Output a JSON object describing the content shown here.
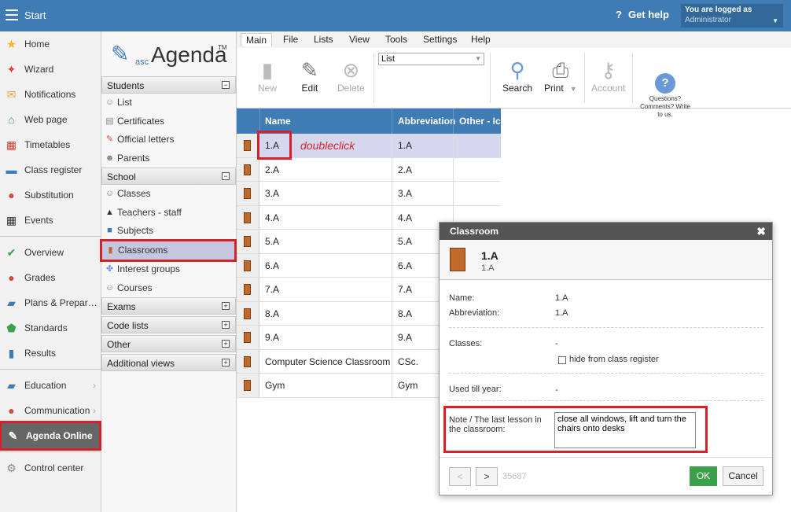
{
  "topbar": {
    "title": "Start",
    "help": "Get help",
    "logged_label": "You are logged as",
    "user": "Administrator"
  },
  "sidebar": {
    "items": [
      {
        "label": "Home",
        "icon": "star-icon",
        "color": "#f2b21d"
      },
      {
        "label": "Wizard",
        "icon": "wand-icon",
        "color": "#d9442c"
      },
      {
        "label": "Notifications",
        "icon": "envelope-icon",
        "color": "#e8a23a"
      },
      {
        "label": "Web page",
        "icon": "house-icon",
        "color": "#3a9a6e"
      },
      {
        "label": "Timetables",
        "icon": "timetable-icon",
        "color": "#d14a3a"
      },
      {
        "label": "Class register",
        "icon": "book-icon",
        "color": "#3f7cb5"
      },
      {
        "label": "Substitution",
        "icon": "person-icon",
        "color": "#d14a3a"
      },
      {
        "label": "Events",
        "icon": "calendar-icon",
        "color": "#333333"
      },
      {
        "label": "Overview",
        "icon": "check-circle-icon",
        "color": "#3aa049"
      },
      {
        "label": "Grades",
        "icon": "grades-icon",
        "color": "#d14a3a"
      },
      {
        "label": "Plans & Prepar…",
        "icon": "briefcase-icon",
        "color": "#3f7cb5"
      },
      {
        "label": "Standards",
        "icon": "shield-icon",
        "color": "#3aa049"
      },
      {
        "label": "Results",
        "icon": "bar-chart-icon",
        "color": "#3f7cb5"
      },
      {
        "label": "Education",
        "icon": "education-icon",
        "color": "#3f7cb5"
      },
      {
        "label": "Communication",
        "icon": "chat-icon",
        "color": "#d14a3a"
      },
      {
        "label": "Agenda Online",
        "icon": "agenda-icon",
        "color": "#ffffff"
      },
      {
        "label": "Control center",
        "icon": "gear-icon",
        "color": "#888888"
      }
    ]
  },
  "logo": {
    "asc": "asc",
    "agenda": "Agenda",
    "tm": "TM"
  },
  "tree": {
    "students": "Students",
    "list": "List",
    "certificates": "Certificates",
    "official_letters": "Official letters",
    "parents": "Parents",
    "school": "School",
    "classes": "Classes",
    "teachers": "Teachers - staff",
    "subjects": "Subjects",
    "classrooms": "Classrooms",
    "interest_groups": "Interest groups",
    "courses": "Courses",
    "exams": "Exams",
    "code_lists": "Code lists",
    "other": "Other",
    "additional_views": "Additional views"
  },
  "tabs": [
    "Main",
    "File",
    "Lists",
    "View",
    "Tools",
    "Settings",
    "Help"
  ],
  "ribbon": {
    "new": "New",
    "edit": "Edit",
    "delete": "Delete",
    "list_select": "List",
    "search": "Search",
    "print": "Print",
    "account": "Account",
    "questions": "Questions? Comments? Write to us."
  },
  "grid": {
    "headers": [
      "Name",
      "Abbreviation",
      "Other - Ico"
    ],
    "rows": [
      [
        "1.A",
        "1.A"
      ],
      [
        "2.A",
        "2.A"
      ],
      [
        "3.A",
        "3.A"
      ],
      [
        "4.A",
        "4.A"
      ],
      [
        "5.A",
        "5.A"
      ],
      [
        "6.A",
        "6.A"
      ],
      [
        "7.A",
        "7.A"
      ],
      [
        "8.A",
        "8.A"
      ],
      [
        "9.A",
        "9.A"
      ],
      [
        "Computer Science Classroom",
        "CSc."
      ],
      [
        "Gym",
        "Gym"
      ]
    ]
  },
  "annotation": "doubleclick",
  "dialog": {
    "title": "Classroom",
    "name": "1.A",
    "abbr": "1.A",
    "name_label": "Name:",
    "name_value": "1.A",
    "abbr_label": "Abbreviation:",
    "abbr_value": "1.A",
    "classes_label": "Classes:",
    "classes_value": "-",
    "hide_label": "hide from class register",
    "used_label": "Used till year:",
    "used_value": "-",
    "note_label": "Note / The last lesson in the classroom:",
    "note_value": "close all windows, lift and turn the chairs onto desks",
    "prev": "<",
    "next": ">",
    "record": "35687",
    "ok": "OK",
    "cancel": "Cancel"
  }
}
